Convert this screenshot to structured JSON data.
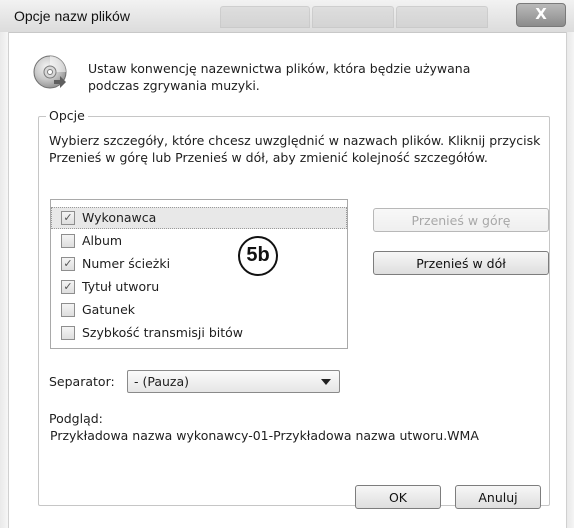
{
  "window": {
    "title": "Opcje nazw plików",
    "close_glyph": "X"
  },
  "intro": {
    "icon": "cd-disc-icon",
    "text": "Ustaw konwencję nazewnictwa plików, która będzie używana podczas zgrywania muzyki."
  },
  "options": {
    "group_title": "Opcje",
    "description": "Wybierz szczegóły, które chcesz uwzględnić w nazwach plików. Kliknij przycisk Przenieś w górę lub Przenieś w dół, aby zmienić kolejność szczegółów.",
    "details": [
      {
        "label": "Wykonawca",
        "checked": true,
        "selected": true
      },
      {
        "label": "Album",
        "checked": false,
        "selected": false
      },
      {
        "label": "Numer ścieżki",
        "checked": true,
        "selected": false
      },
      {
        "label": "Tytuł utworu",
        "checked": true,
        "selected": false
      },
      {
        "label": "Gatunek",
        "checked": false,
        "selected": false
      },
      {
        "label": "Szybkość transmisji bitów",
        "checked": false,
        "selected": false
      }
    ],
    "move_up_label": "Przenieś w górę",
    "move_down_label": "Przenieś w dół",
    "separator_label": "Separator:",
    "separator_value": "- (Pauza)",
    "preview_label": "Podgląd:",
    "preview_value": "Przykładowa nazwa wykonawcy-01-Przykładowa nazwa utworu.WMA"
  },
  "annotation": {
    "badge_text": "5b"
  },
  "footer": {
    "ok_label": "OK",
    "cancel_label": "Anuluj"
  },
  "colors": {
    "check_mark": "#555555",
    "disabled_text": "#a8a8a8"
  }
}
